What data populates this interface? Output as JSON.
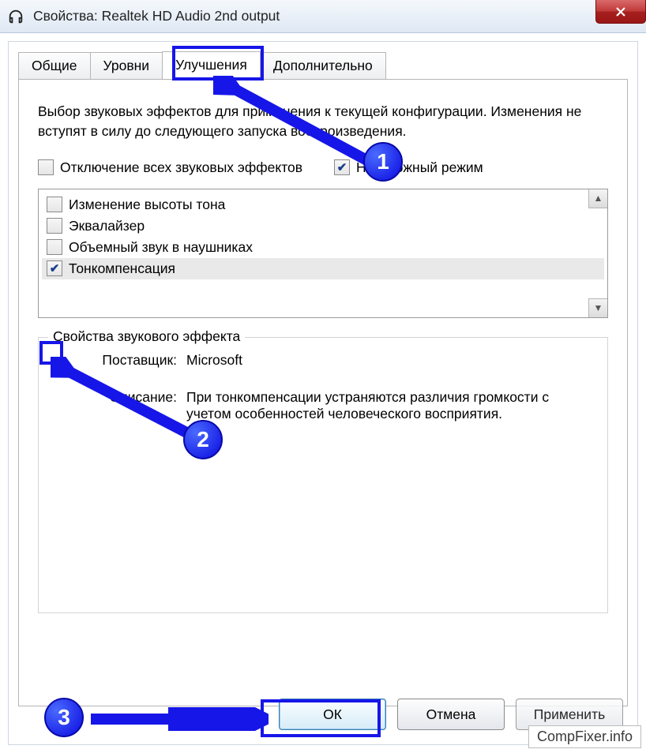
{
  "window": {
    "title": "Свойства: Realtek HD Audio 2nd output"
  },
  "tabs": {
    "general": "Общие",
    "levels": "Уровни",
    "enhancements": "Улучшения",
    "advanced": "Дополнительно"
  },
  "panel": {
    "intro": "Выбор звуковых эффектов для применения к текущей конфигурации. Изменения не вступят в силу до следующего запуска воспроизведения.",
    "disable_all": "Отключение всех звуковых эффектов",
    "immediate_mode": "Неотложный режим",
    "effects": [
      "Изменение высоты тона",
      "Эквалайзер",
      "Объемный звук в наушниках",
      "Тонкомпенсация"
    ],
    "group_title": "Свойства звукового эффекта",
    "provider_label": "Поставщик:",
    "provider_value": "Microsoft",
    "desc_label": "Описание:",
    "desc_value": "При тонкомпенсации устраняются различия громкости с учетом особенностей человеческого восприятия."
  },
  "buttons": {
    "ok": "ОК",
    "cancel": "Отмена",
    "apply": "Применить"
  },
  "annotations": {
    "n1": "1",
    "n2": "2",
    "n3": "3"
  },
  "watermark": "CompFixer.info"
}
